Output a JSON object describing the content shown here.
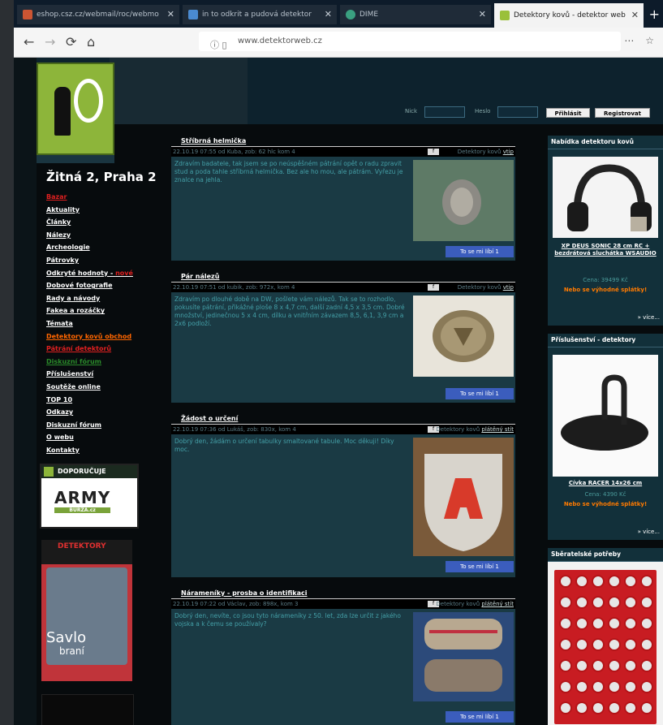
{
  "browser": {
    "tabs": [
      {
        "label": "eshop.csz.cz/webmail/roc/webmo",
        "color": "#cc5533"
      },
      {
        "label": "in to odkrit a pudová detektor",
        "color": "#4a8ad0"
      },
      {
        "label": "DIME",
        "color": "#3aa080"
      },
      {
        "label": "Detektory kovů - detektor web",
        "color": "#9ac03a"
      }
    ],
    "new_tab": "+",
    "url": "www.detektorweb.cz",
    "nav_icons": [
      "back-icon",
      "forward-icon",
      "reload-icon",
      "home-icon"
    ]
  },
  "header": {
    "login_label": "Nick",
    "password_label": "Heslo",
    "login_button": "Přihlásit",
    "register_button": "Registrovat"
  },
  "sidebar": {
    "district": "Žitná 2, Praha 2",
    "menu": [
      {
        "label": "Bazar",
        "style": "red"
      },
      {
        "label": "Aktuality",
        "style": "white"
      },
      {
        "label": "Články",
        "style": "white"
      },
      {
        "label": "Nálezy",
        "style": "white"
      },
      {
        "label": "Archeologie",
        "style": "white"
      },
      {
        "label": "Pátrovky",
        "style": "white"
      },
      {
        "label": "Odkryté hodnoty - ",
        "style": "white",
        "badge": "nové"
      },
      {
        "label": "Dobové fotografie",
        "style": "white"
      },
      {
        "label": "Rady a návody",
        "style": "white"
      },
      {
        "label": "Fakea a rozáčky",
        "style": "white"
      },
      {
        "label": "Témata",
        "style": "white"
      },
      {
        "label": "Detektory kovů obchod",
        "style": "orange"
      },
      {
        "label": "Pátrání detektorů",
        "style": "red"
      },
      {
        "label": "Diskuzní fórum",
        "style": "green"
      },
      {
        "label": "Příslušenství",
        "style": "white"
      },
      {
        "label": "Soutěže online",
        "style": "white"
      },
      {
        "label": "TOP 10",
        "style": "white"
      },
      {
        "label": "Odkazy",
        "style": "white"
      },
      {
        "label": "Diskuzní fórum",
        "style": "white"
      },
      {
        "label": "O webu",
        "style": "white"
      },
      {
        "label": "Kontakty",
        "style": "white"
      }
    ],
    "ad_doporucuje": "DOPORUČUJE",
    "ad_army": "ARMY",
    "ad_army_sub": "BURZA.cz",
    "mag_title": "DETEKTORY",
    "mag_big": "Savlo",
    "mag_small": "braní"
  },
  "posts": [
    {
      "title": "Stříbrná helmička",
      "meta": "22.10.19 07:55 od Kuba, zob: 62 hlc kom 4",
      "fb": "f",
      "detail": "Detektory kovů",
      "link": "vtip",
      "body": "Zdravím badatele, tak jsem se po neúspěšném pátrání opět o radu zpravit stud a poda tahle stříbrná helmička. Bez ale ho mou, ale pátrám. Vyřezu je znalce na jehla.",
      "like": "To se mi líbí 1"
    },
    {
      "title": "Pár nálezů",
      "meta": "22.10.19 07:51 od kubik, zob: 972x, kom 4",
      "fb": "f",
      "detail": "Detektory kovů",
      "link": "vtip",
      "body": "Zdravím po dlouhé době na DW, pošlete vám nálezů. Tak se to rozhodlo, pokusíte pátrání, přikážné ploše 8 x 4,7 cm, další zadní 4,5 x 3,5 cm. Dobré množství, jedinečnou 5 x 4 cm, dílku a vnitřním závazem 8,5, 6,1, 3,9 cm a 2x6 podloží.",
      "like": "To se mi líbí 1"
    },
    {
      "title": "Žádost o určení",
      "meta": "22.10.19 07:36 od Lukáš, zob: 830x, kom 4",
      "fb": "f",
      "detail": "Detektory kovů",
      "link": "plátěný stít",
      "body": "Dobrý den, žádám o určení tabulky smaltované tabule. Moc děkuji! Díky moc.",
      "like": "To se mi líbí 1"
    },
    {
      "title": "Nárameníky - prosba o identifikaci",
      "meta": "22.10.19 07:22 od Václav, zob: 898x, kom 3",
      "fb": "f",
      "detail": "Detektory kovů",
      "link": "plátěný stít",
      "body": "Dobrý den, nevíte, co jsou tyto nárameníky z 50. let, zda lze určit z jakého vojska a k čemu se používaly?",
      "like": "To se mi líbí 1"
    }
  ],
  "right": {
    "box1": {
      "title": "Nabídka detektoru kovů",
      "product": "XP DEUS SONIC 28 cm RC + bezdrátová sluchátka WSAUDIO",
      "price": "Cena: 39499 Kč",
      "offer": "Nebo se výhodné splátky!",
      "more": "» více..."
    },
    "box2": {
      "title": "Příslušenství - detektory",
      "product": "Cívka RACER 14x26 cm",
      "price": "Cena: 4390 Kč",
      "offer": "Nebo se výhodné splátky!",
      "more": "» více..."
    },
    "box3": {
      "title": "Sběratelské potřeby"
    }
  },
  "colors": {
    "accent_green": "#8db53a",
    "post_body_bg": "#1a3a44",
    "post_text": "#44a0a8",
    "offer_orange": "#ff7a00",
    "menu_red": "#e02020"
  }
}
